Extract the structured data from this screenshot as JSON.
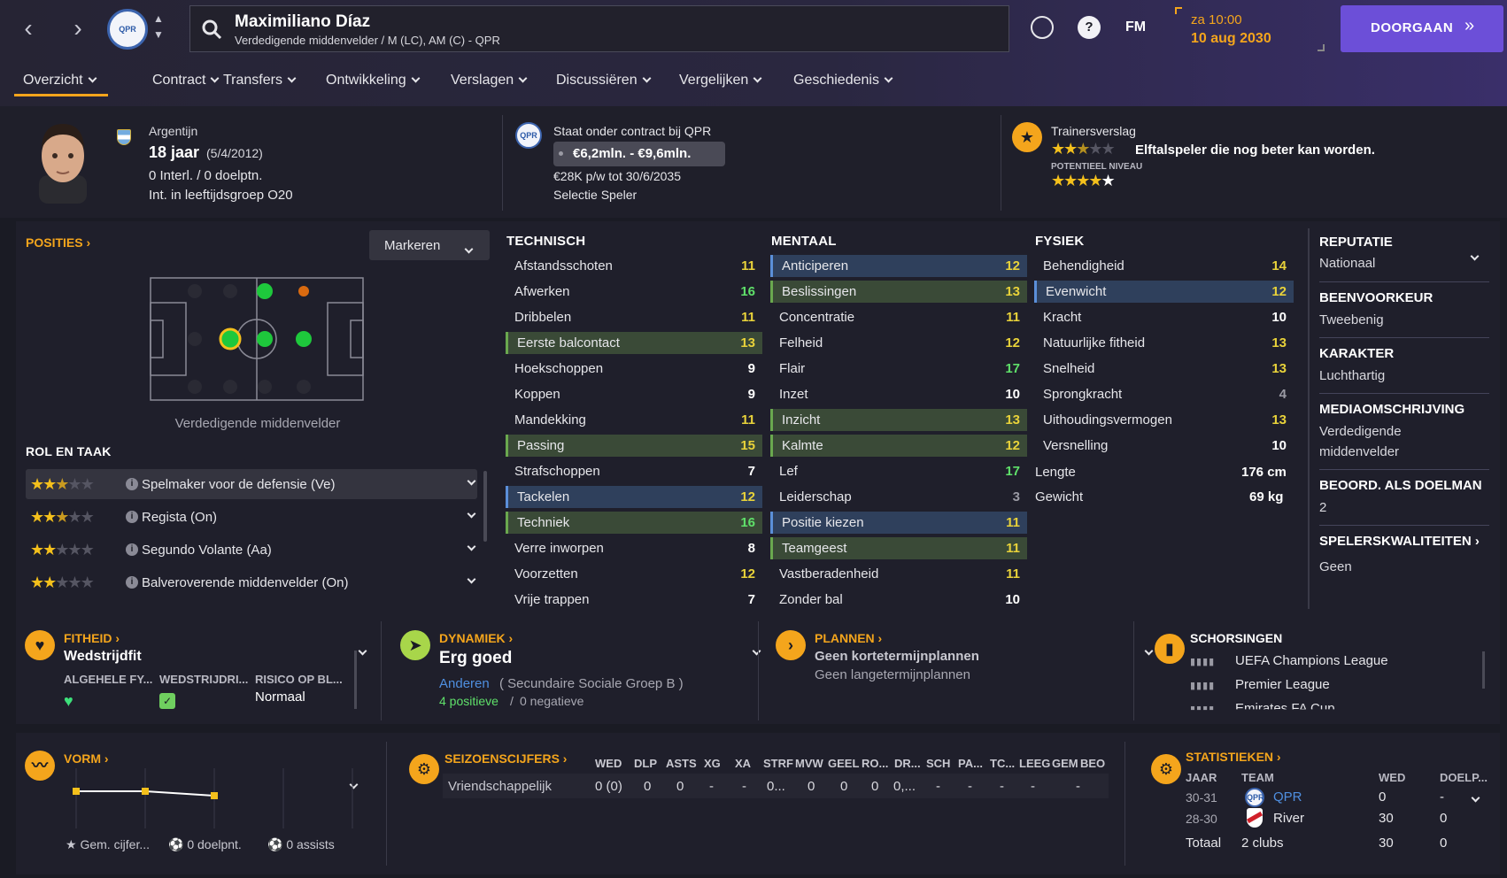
{
  "header": {
    "player_name": "Maximiliano Díaz",
    "player_subtitle": "Verdedigende middenvelder / M (LC), AM (C) - QPR",
    "fm_label": "FM",
    "time": "za 10:00",
    "date": "10 aug 2030",
    "continue_label": "DOORGAAN"
  },
  "tabs": [
    "Overzicht",
    "Contract",
    "Transfers",
    "Ontwikkeling",
    "Verslagen",
    "Discussiëren",
    "Vergelijken",
    "Geschiedenis"
  ],
  "profile": {
    "nationality": "Argentijn",
    "age": "18 jaar",
    "dob": "(5/4/2012)",
    "caps": "0 Interl. / 0 doelptn.",
    "intl_group": "Int. in leeftijdsgroep O20"
  },
  "contract": {
    "title": "Staat onder contract bij QPR",
    "value_range": "€6,2mln. - €9,6mln.",
    "wage": "€28K p/w tot 30/6/2035",
    "status": "Selectie Speler"
  },
  "scout": {
    "title": "Trainersverslag",
    "summary": "Elftalspeler die nog beter kan worden.",
    "potential_label": "POTENTIEEL NIVEAU",
    "current_stars": 2.5,
    "potential_stars": 4.5
  },
  "positions": {
    "title": "POSITIES",
    "dropdown": "Markeren",
    "caption": "Verdedigende middenvelder",
    "roles_title": "ROL EN TAAK",
    "roles": [
      {
        "label": "Spelmaker voor de defensie (Ve)",
        "stars": 2.5
      },
      {
        "label": "Regista (On)",
        "stars": 2.5
      },
      {
        "label": "Segundo Volante (Aa)",
        "stars": 2
      },
      {
        "label": "Balveroverende middenvelder (On)",
        "stars": 2
      }
    ]
  },
  "attributes": {
    "technical_title": "TECHNISCH",
    "mental_title": "MENTAAL",
    "physical_title": "FYSIEK",
    "technical": [
      {
        "name": "Afstandsschoten",
        "value": "11",
        "hl": ""
      },
      {
        "name": "Afwerken",
        "value": "16",
        "hl": ""
      },
      {
        "name": "Dribbelen",
        "value": "11",
        "hl": ""
      },
      {
        "name": "Eerste balcontact",
        "value": "13",
        "hl": "green"
      },
      {
        "name": "Hoekschoppen",
        "value": "9",
        "hl": ""
      },
      {
        "name": "Koppen",
        "value": "9",
        "hl": ""
      },
      {
        "name": "Mandekking",
        "value": "11",
        "hl": ""
      },
      {
        "name": "Passing",
        "value": "15",
        "hl": "green"
      },
      {
        "name": "Strafschoppen",
        "value": "7",
        "hl": ""
      },
      {
        "name": "Tackelen",
        "value": "12",
        "hl": "blue"
      },
      {
        "name": "Techniek",
        "value": "16",
        "hl": "green"
      },
      {
        "name": "Verre inworpen",
        "value": "8",
        "hl": ""
      },
      {
        "name": "Voorzetten",
        "value": "12",
        "hl": ""
      },
      {
        "name": "Vrije trappen",
        "value": "7",
        "hl": ""
      }
    ],
    "mental": [
      {
        "name": "Anticiperen",
        "value": "12",
        "hl": "blue"
      },
      {
        "name": "Beslissingen",
        "value": "13",
        "hl": "green"
      },
      {
        "name": "Concentratie",
        "value": "11",
        "hl": ""
      },
      {
        "name": "Felheid",
        "value": "12",
        "hl": ""
      },
      {
        "name": "Flair",
        "value": "17",
        "hl": ""
      },
      {
        "name": "Inzet",
        "value": "10",
        "hl": ""
      },
      {
        "name": "Inzicht",
        "value": "13",
        "hl": "green"
      },
      {
        "name": "Kalmte",
        "value": "12",
        "hl": "green"
      },
      {
        "name": "Lef",
        "value": "17",
        "hl": ""
      },
      {
        "name": "Leiderschap",
        "value": "3",
        "hl": ""
      },
      {
        "name": "Positie kiezen",
        "value": "11",
        "hl": "blue"
      },
      {
        "name": "Teamgeest",
        "value": "11",
        "hl": "green"
      },
      {
        "name": "Vastberadenheid",
        "value": "11",
        "hl": ""
      },
      {
        "name": "Zonder bal",
        "value": "10",
        "hl": ""
      }
    ],
    "physical": [
      {
        "name": "Behendigheid",
        "value": "14",
        "hl": ""
      },
      {
        "name": "Evenwicht",
        "value": "12",
        "hl": "blue"
      },
      {
        "name": "Kracht",
        "value": "10",
        "hl": ""
      },
      {
        "name": "Natuurlijke fitheid",
        "value": "13",
        "hl": ""
      },
      {
        "name": "Snelheid",
        "value": "13",
        "hl": ""
      },
      {
        "name": "Sprongkracht",
        "value": "4",
        "hl": ""
      },
      {
        "name": "Uithoudingsvermogen",
        "value": "13",
        "hl": ""
      },
      {
        "name": "Versnelling",
        "value": "10",
        "hl": ""
      }
    ],
    "height_label": "Lengte",
    "height": "176 cm",
    "weight_label": "Gewicht",
    "weight": "69 kg"
  },
  "side": {
    "reputation_title": "REPUTATIE",
    "reputation": "Nationaal",
    "foot_title": "BEENVOORKEUR",
    "foot": "Tweebenig",
    "character_title": "KARAKTER",
    "character": "Luchthartig",
    "media_title": "MEDIAOMSCHRIJVING",
    "media_1": "Verdedigende",
    "media_2": "middenvelder",
    "gk_title": "BEOORD. ALS DOELMAN",
    "gk": "2",
    "qualities_title": "SPELERSKWALITEITEN",
    "qualities": "Geen"
  },
  "fitness": {
    "title": "FITHEID",
    "status": "Wedstrijdfit",
    "col1": "ALGEHELE FY...",
    "col2": "WEDSTRIJDRI...",
    "col3": "RISICO OP BL...",
    "risk": "Normaal"
  },
  "dynamics": {
    "title": "DYNAMIEK",
    "status": "Erg goed",
    "group_link": "Anderen",
    "group": "( Secundaire Sociale Groep B )",
    "positive": "4 positieve",
    "negative": "0 negatieve"
  },
  "plans": {
    "title": "PLANNEN",
    "short": "Geen kortetermijnplannen",
    "long": "Geen langetermijnplannen"
  },
  "suspensions": {
    "title": "SCHORSINGEN",
    "items": [
      "UEFA Champions League",
      "Premier League",
      "Emirates FA Cup"
    ]
  },
  "form": {
    "title": "VORM",
    "avg_rating": "Gem. cijfer...",
    "goals": "0 doelpnt.",
    "assists": "0 assists"
  },
  "season": {
    "title": "SEIZOENSCIJFERS",
    "headers": [
      "WED",
      "DLP",
      "ASTS",
      "XG",
      "XA",
      "STRF",
      "MVW",
      "GEEL",
      "RO...",
      "DR...",
      "SCH",
      "PA...",
      "TC...",
      "LEEG",
      "GEM",
      "BEO"
    ],
    "row_label": "Vriendschappelijk",
    "row": [
      "0 (0)",
      "0",
      "0",
      "-",
      "-",
      "0...",
      "0",
      "0",
      "0",
      "0,...",
      "-",
      "-",
      "-",
      "-",
      "-"
    ]
  },
  "stats": {
    "title": "STATISTIEKEN",
    "col_year": "JAAR",
    "col_team": "TEAM",
    "col_games": "WED",
    "col_goals": "DOELP...",
    "rows": [
      {
        "year": "30-31",
        "team": "QPR",
        "games": "0",
        "goals": "-"
      },
      {
        "year": "28-30",
        "team": "River",
        "games": "30",
        "goals": "0"
      }
    ],
    "total_label": "Totaal",
    "total_clubs": "2 clubs",
    "total_games": "30",
    "total_goals": "0"
  },
  "colors": {
    "accent": "#f4a51c",
    "continue": "#6c4fd8",
    "good": "#5fe06a"
  }
}
